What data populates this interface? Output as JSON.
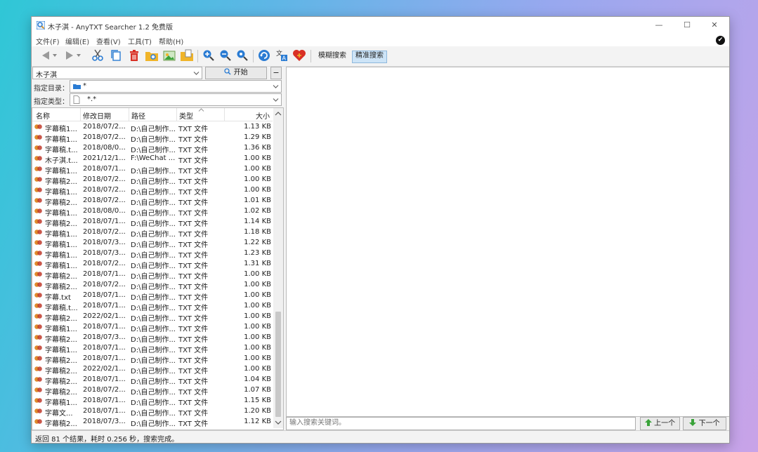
{
  "window": {
    "title": "木子淇 - AnyTXT Searcher 1.2 免费版",
    "minimize": "—",
    "maximize": "☐",
    "close": "✕"
  },
  "menu": [
    "文件(F)",
    "编辑(E)",
    "查看(V)",
    "工具(T)",
    "帮助(H)"
  ],
  "toolbar": {
    "mode_fuzzy": "模糊搜索",
    "mode_exact": "精准搜索",
    "active_mode": "exact"
  },
  "search": {
    "query": "木子淇",
    "start_button": "开始",
    "dir_label": "指定目录：",
    "dir_value": "*",
    "type_label": "指定类型：",
    "type_value": "*.*"
  },
  "columns": {
    "name": "名称",
    "mtime": "修改日期",
    "path": "路径",
    "type": "类型",
    "size": "大小"
  },
  "rows": [
    {
      "name": "字幕稿1...",
      "date": "2018/07/2...",
      "path": "D:\\自己制作...",
      "type": "TXT 文件",
      "size": "1.13 KB"
    },
    {
      "name": "字幕稿1...",
      "date": "2018/07/2...",
      "path": "D:\\自己制作...",
      "type": "TXT 文件",
      "size": "1.29 KB"
    },
    {
      "name": "字幕稿.t...",
      "date": "2018/08/0...",
      "path": "D:\\自己制作...",
      "type": "TXT 文件",
      "size": "1.36 KB"
    },
    {
      "name": "木子淇.t...",
      "date": "2021/12/1...",
      "path": "F:\\WeChat ...",
      "type": "TXT 文件",
      "size": "1.00 KB"
    },
    {
      "name": "字幕稿1...",
      "date": "2018/07/1...",
      "path": "D:\\自己制作...",
      "type": "TXT 文件",
      "size": "1.00 KB"
    },
    {
      "name": "字幕稿2...",
      "date": "2018/07/2...",
      "path": "D:\\自己制作...",
      "type": "TXT 文件",
      "size": "1.00 KB"
    },
    {
      "name": "字幕稿1...",
      "date": "2018/07/2...",
      "path": "D:\\自己制作...",
      "type": "TXT 文件",
      "size": "1.00 KB"
    },
    {
      "name": "字幕稿2...",
      "date": "2018/07/2...",
      "path": "D:\\自己制作...",
      "type": "TXT 文件",
      "size": "1.01 KB"
    },
    {
      "name": "字幕稿1...",
      "date": "2018/08/0...",
      "path": "D:\\自己制作...",
      "type": "TXT 文件",
      "size": "1.02 KB"
    },
    {
      "name": "字幕稿2...",
      "date": "2018/07/1...",
      "path": "D:\\自己制作...",
      "type": "TXT 文件",
      "size": "1.14 KB"
    },
    {
      "name": "字幕稿1...",
      "date": "2018/07/2...",
      "path": "D:\\自己制作...",
      "type": "TXT 文件",
      "size": "1.18 KB"
    },
    {
      "name": "字幕稿1...",
      "date": "2018/07/3...",
      "path": "D:\\自己制作...",
      "type": "TXT 文件",
      "size": "1.22 KB"
    },
    {
      "name": "字幕稿1...",
      "date": "2018/07/3...",
      "path": "D:\\自己制作...",
      "type": "TXT 文件",
      "size": "1.23 KB"
    },
    {
      "name": "字幕稿1...",
      "date": "2018/07/2...",
      "path": "D:\\自己制作...",
      "type": "TXT 文件",
      "size": "1.31 KB"
    },
    {
      "name": "字幕稿2...",
      "date": "2018/07/1...",
      "path": "D:\\自己制作...",
      "type": "TXT 文件",
      "size": "1.00 KB"
    },
    {
      "name": "字幕稿2...",
      "date": "2018/07/2...",
      "path": "D:\\自己制作...",
      "type": "TXT 文件",
      "size": "1.00 KB"
    },
    {
      "name": "字幕.txt",
      "date": "2018/07/1...",
      "path": "D:\\自己制作...",
      "type": "TXT 文件",
      "size": "1.00 KB"
    },
    {
      "name": "字幕稿.t...",
      "date": "2018/07/1...",
      "path": "D:\\自己制作...",
      "type": "TXT 文件",
      "size": "1.00 KB"
    },
    {
      "name": "字幕稿2...",
      "date": "2022/02/1...",
      "path": "D:\\自己制作...",
      "type": "TXT 文件",
      "size": "1.00 KB"
    },
    {
      "name": "字幕稿1...",
      "date": "2018/07/1...",
      "path": "D:\\自己制作...",
      "type": "TXT 文件",
      "size": "1.00 KB"
    },
    {
      "name": "字幕稿2...",
      "date": "2018/07/3...",
      "path": "D:\\自己制作...",
      "type": "TXT 文件",
      "size": "1.00 KB"
    },
    {
      "name": "字幕稿1...",
      "date": "2018/07/1...",
      "path": "D:\\自己制作...",
      "type": "TXT 文件",
      "size": "1.00 KB"
    },
    {
      "name": "字幕稿2...",
      "date": "2018/07/1...",
      "path": "D:\\自己制作...",
      "type": "TXT 文件",
      "size": "1.00 KB"
    },
    {
      "name": "字幕稿2...",
      "date": "2022/02/1...",
      "path": "D:\\自己制作...",
      "type": "TXT 文件",
      "size": "1.00 KB"
    },
    {
      "name": "字幕稿2...",
      "date": "2018/07/1...",
      "path": "D:\\自己制作...",
      "type": "TXT 文件",
      "size": "1.04 KB"
    },
    {
      "name": "字幕稿2...",
      "date": "2018/07/2...",
      "path": "D:\\自己制作...",
      "type": "TXT 文件",
      "size": "1.07 KB"
    },
    {
      "name": "字幕稿1...",
      "date": "2018/07/1...",
      "path": "D:\\自己制作...",
      "type": "TXT 文件",
      "size": "1.15 KB"
    },
    {
      "name": "字幕文...",
      "date": "2018/07/1...",
      "path": "D:\\自己制作...",
      "type": "TXT 文件",
      "size": "1.20 KB"
    },
    {
      "name": "字幕稿2...",
      "date": "2018/07/3...",
      "path": "D:\\自己制作...",
      "type": "TXT 文件",
      "size": "1.12 KB"
    }
  ],
  "find": {
    "placeholder": "输入搜索关键词。",
    "prev": "上一个",
    "next": "下一个"
  },
  "status": "返回 81 个结果，耗时 0.256 秒，搜索完成。",
  "colors": {
    "accent": "#2b7cd3",
    "delete_red": "#d93025",
    "folder_yellow": "#f0b429",
    "mode_active_bg": "#cde4f7",
    "arrow_green": "#3aa33a"
  }
}
